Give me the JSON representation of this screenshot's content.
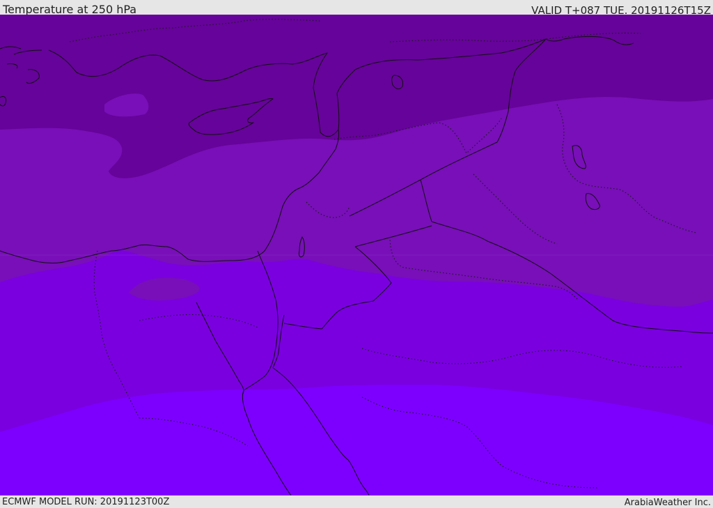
{
  "header": {
    "title": "Temperature at 250 hPa",
    "valid_time": "VALID T+087 TUE. 20191126T15Z"
  },
  "footer": {
    "model_run": "ECMWF MODEL RUN: 20191123T00Z",
    "credit": "ArabiaWeather Inc."
  },
  "map": {
    "variable": "Temperature",
    "level": "250 hPa",
    "colors": {
      "coldest_band": "#66039a",
      "cold_band": "#780fb8",
      "mid_band": "#7a00e0",
      "warm_band": "#7d00ff",
      "frame": "#e6e6e6"
    }
  }
}
